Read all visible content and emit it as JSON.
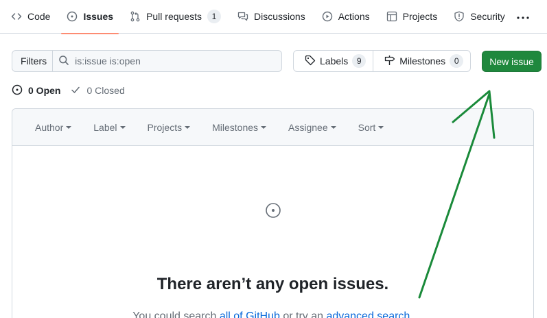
{
  "nav": {
    "items": [
      {
        "label": "Code",
        "icon": "code-icon"
      },
      {
        "label": "Issues",
        "icon": "issue-opened-icon",
        "active": true
      },
      {
        "label": "Pull requests",
        "icon": "git-pull-request-icon",
        "count": "1"
      },
      {
        "label": "Discussions",
        "icon": "comment-discussion-icon"
      },
      {
        "label": "Actions",
        "icon": "play-icon"
      },
      {
        "label": "Projects",
        "icon": "table-icon"
      },
      {
        "label": "Security",
        "icon": "shield-icon"
      }
    ],
    "more_icon": "kebab-horizontal-icon",
    "active_underline_color": "#fd8c73"
  },
  "filters": {
    "button_label": "Filters",
    "search_value": "is:issue is:open"
  },
  "labels": {
    "label": "Labels",
    "count": "9"
  },
  "milestones": {
    "label": "Milestones",
    "count": "0"
  },
  "new_issue": {
    "label": "New issue",
    "color": "#1f883d"
  },
  "states": {
    "open": "0 Open",
    "closed": "0 Closed"
  },
  "sort_bar": [
    "Author",
    "Label",
    "Projects",
    "Milestones",
    "Assignee",
    "Sort"
  ],
  "blank": {
    "title": "There aren’t any open issues.",
    "sub_prefix": "You could search ",
    "link1": "all of GitHub",
    "sub_middle": " or try an ",
    "link2": "advanced search",
    "sub_suffix": "."
  },
  "annotation": {
    "color": "#1a8a3a",
    "icon": "arrow-annotation"
  }
}
